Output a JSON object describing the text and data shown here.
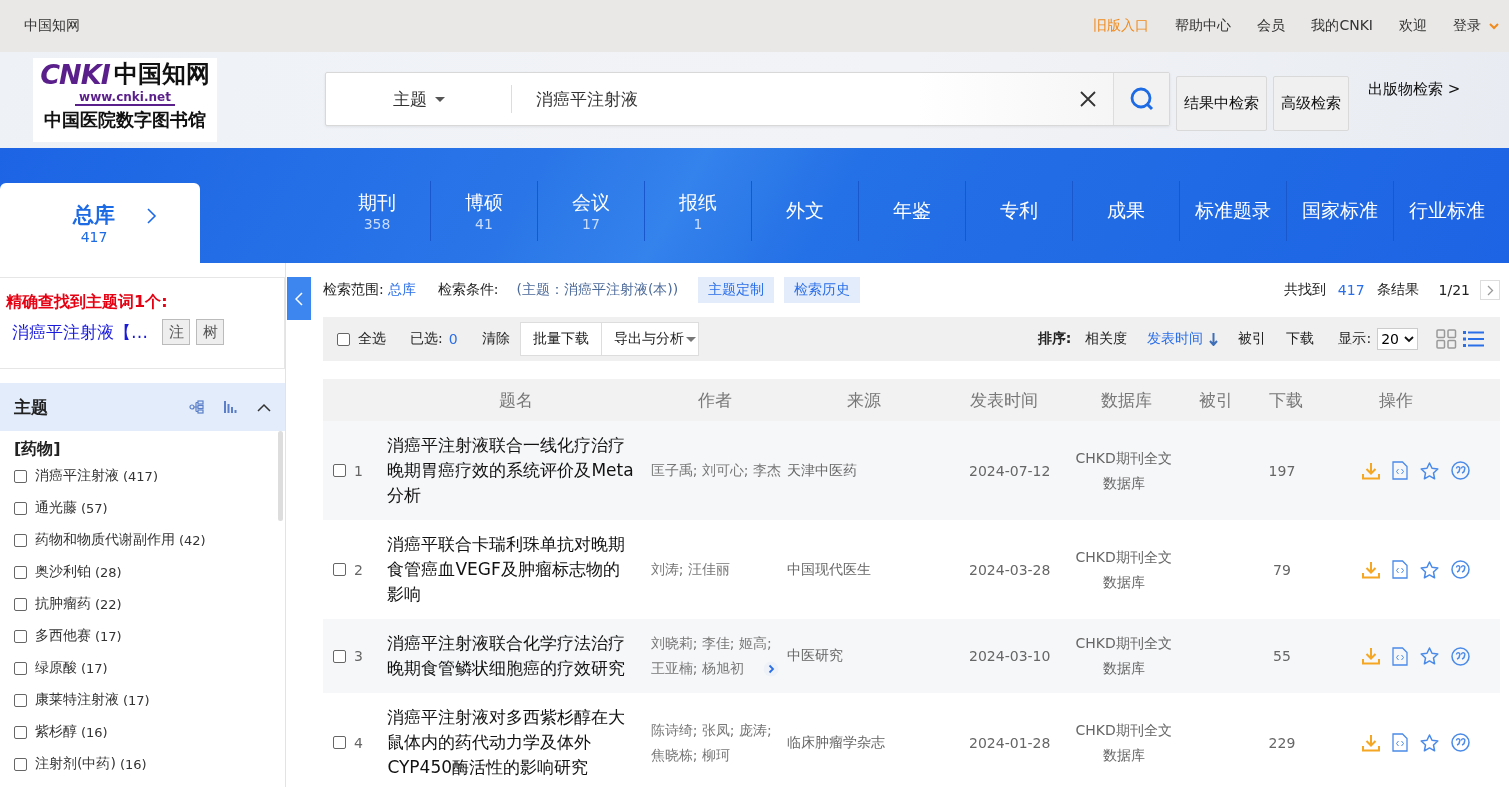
{
  "top_bar": {
    "site_name": "中国知网",
    "links": [
      {
        "label": "旧版入口",
        "highlight": true
      },
      {
        "label": "帮助中心",
        "highlight": false
      },
      {
        "label": "会员",
        "highlight": false
      },
      {
        "label": "我的CNKI",
        "highlight": false
      },
      {
        "label": "欢迎",
        "highlight": false
      }
    ],
    "login": "登录"
  },
  "header": {
    "logo": {
      "brand": "CNKI",
      "brand_cn": "中国知网",
      "url": "www.cnki.net",
      "library": "中国医院数字图书馆"
    },
    "search": {
      "field": "主题",
      "value": "消癌平注射液"
    },
    "buttons": [
      "结果中检索",
      "高级检索"
    ],
    "publication_search": "出版物检索 >"
  },
  "database_tabs": {
    "main": {
      "label": "总库",
      "count": "417"
    },
    "tabs": [
      {
        "label": "期刊",
        "count": "358"
      },
      {
        "label": "博硕",
        "count": "41"
      },
      {
        "label": "会议",
        "count": "17"
      },
      {
        "label": "报纸",
        "count": "1"
      },
      {
        "label": "外文"
      },
      {
        "label": "年鉴"
      },
      {
        "label": "专利"
      },
      {
        "label": "成果"
      },
      {
        "label": "标准题录"
      },
      {
        "label": "国家标准"
      },
      {
        "label": "行业标准"
      }
    ]
  },
  "precise_topic": {
    "heading": "精确查找到主题词1个:",
    "term": "消癌平注射液【…",
    "buttons": [
      "注",
      "树"
    ]
  },
  "facet": {
    "title": "主题",
    "group": "[药物]",
    "items": [
      {
        "label": "消癌平注射液",
        "count": "(417)",
        "checked": false
      },
      {
        "label": "通光藤",
        "count": "(57)",
        "checked": false
      },
      {
        "label": "药物和物质代谢副作用",
        "count": "(42)",
        "checked": false
      },
      {
        "label": "奥沙利铂",
        "count": "(28)",
        "checked": false
      },
      {
        "label": "抗肿瘤药",
        "count": "(22)",
        "checked": false
      },
      {
        "label": "多西他赛",
        "count": "(17)",
        "checked": false
      },
      {
        "label": "绿原酸",
        "count": "(17)",
        "checked": false
      },
      {
        "label": "康莱特注射液",
        "count": "(17)",
        "checked": false
      },
      {
        "label": "紫杉醇",
        "count": "(16)",
        "checked": false
      },
      {
        "label": "注射剂(中药)",
        "count": "(16)",
        "checked": false
      }
    ]
  },
  "search_info": {
    "scope_label": "检索范围:",
    "scope": "总库",
    "condition_label": "检索条件:",
    "condition": "(主题：消癌平注射液(本))",
    "buttons": [
      "主题定制",
      "检索历史"
    ],
    "found_prefix": "共找到",
    "found_count": "417",
    "found_suffix": "条结果",
    "page": "1/21"
  },
  "toolbar": {
    "select_all": {
      "label": "全选",
      "checked": false
    },
    "selected_label": "已选:",
    "selected_count": "0",
    "clear": "清除",
    "batch_download": "批量下载",
    "export": "导出与分析",
    "sort_label": "排序:",
    "sort_options": [
      {
        "label": "相关度",
        "selected": false,
        "arrow": false
      },
      {
        "label": "发表时间",
        "selected": true,
        "arrow": true
      },
      {
        "label": "被引",
        "selected": false,
        "arrow": false
      },
      {
        "label": "下载",
        "selected": false,
        "arrow": false
      }
    ],
    "display_label": "显示:",
    "page_size": "20",
    "views": [
      {
        "kind": "grid",
        "selected": false
      },
      {
        "kind": "list",
        "selected": true
      }
    ]
  },
  "table": {
    "columns": [
      "题名",
      "作者",
      "来源",
      "发表时间",
      "数据库",
      "被引",
      "下载",
      "操作"
    ],
    "rows": [
      {
        "index": "1",
        "checked": false,
        "title": "消癌平注射液联合一线化疗治疗晚期胃癌疗效的系统评价及Meta分析",
        "authors": "匡子禹; 刘可心; 李杰",
        "more_authors": false,
        "source": "天津中医药",
        "date": "2024-07-12",
        "database": "CHKD期刊全文数据库",
        "downloads": "197"
      },
      {
        "index": "2",
        "checked": false,
        "title": "消癌平联合卡瑞利珠单抗对晚期食管癌血VEGF及肿瘤标志物的影响",
        "authors": "刘涛; 汪佳丽",
        "more_authors": false,
        "source": "中国现代医生",
        "date": "2024-03-28",
        "database": "CHKD期刊全文数据库",
        "downloads": "79"
      },
      {
        "index": "3",
        "checked": false,
        "title": "消癌平注射液联合化学疗法治疗晚期食管鳞状细胞癌的疗效研究",
        "authors": "刘晓莉; 李佳; 姬高; 王亚楠; 杨旭初",
        "more_authors": true,
        "source": "中医研究",
        "date": "2024-03-10",
        "database": "CHKD期刊全文数据库",
        "downloads": "55"
      },
      {
        "index": "4",
        "checked": false,
        "title": "消癌平注射液对多西紫杉醇在大鼠体内的药代动力学及体外CYP450酶活性的影响研究",
        "authors": "陈诗绮; 张凤; 庞涛; 焦晓栋; 柳珂",
        "more_authors": false,
        "source": "临床肿瘤学杂志",
        "date": "2024-01-28",
        "database": "CHKD期刊全文数据库",
        "downloads": "229"
      }
    ]
  }
}
